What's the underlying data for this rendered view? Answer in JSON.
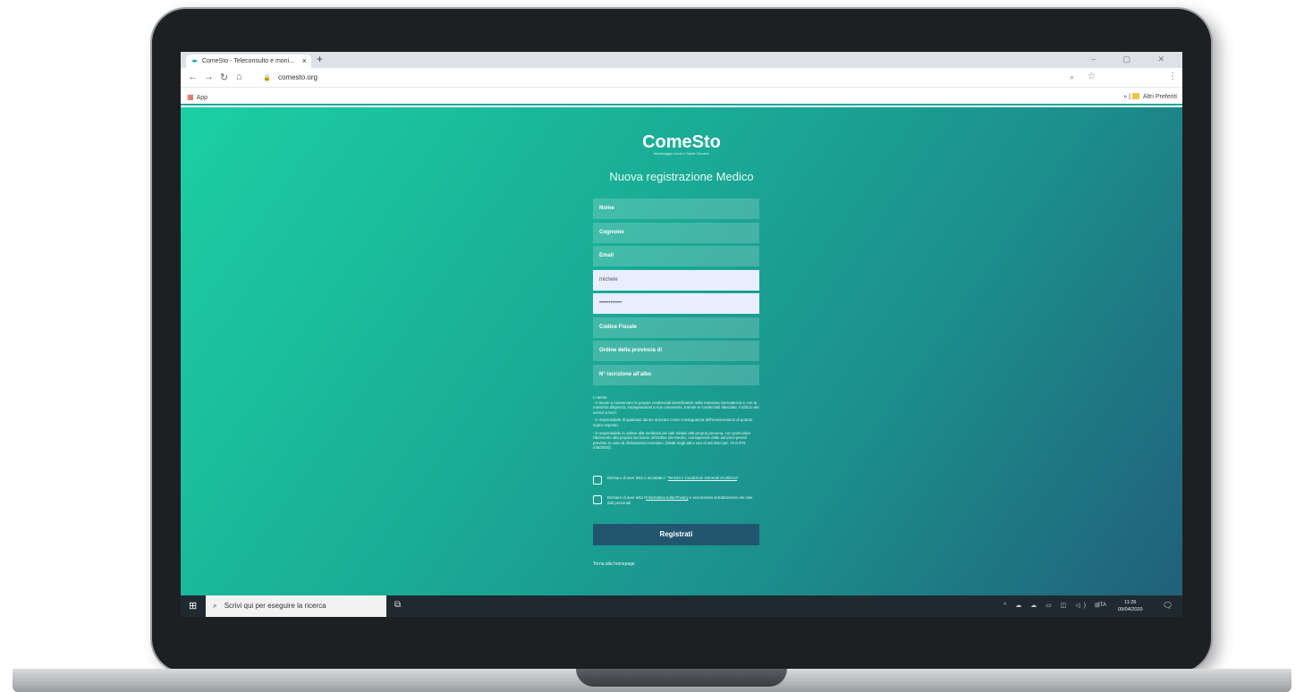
{
  "browser": {
    "tab_title": "ComeSto - Teleconsulto e moni...",
    "tab_close": "×",
    "new_tab": "+",
    "window_controls": "– ▢ ✕",
    "url": "comesto.org",
    "bookmarks_apps": "App",
    "bookmarks_other_prefix": "»",
    "bookmarks_other": "Altri Preferiti"
  },
  "page": {
    "logo": "ComeSto",
    "logo_subtitle": "Monitoraggio cronici e Salute Circolare",
    "title": "Nuova registrazione Medico",
    "fields": {
      "nome": "Nome",
      "cognome": "Cognome",
      "email": "Email",
      "username": "michele",
      "password": "••••••••••••",
      "codice_fiscale": "Codice Fiscale",
      "ordine": "Ordine della provincia di",
      "iscrizione": "N° iscrizione all'albo"
    },
    "notice": {
      "intro": "L'utente:",
      "p1": "- è tenuto a conservare le proprie credenziali identificative nella massima riservatezza e con la massima diligenza, impegnandosi a non consentire, tramite le credenziali rilasciate, l'utilizzo dei servizi a terzi;",
      "p2": "- è responsabile di qualsiasi danno arrecato come conseguenza dell'inosservanza di quanto sopra esposto;",
      "p3": "- è responsabile in ordine alla veridicità dei dati relativi alla propria persona, con particolare riferimento alla propria iscrizione all'Ordine dei Medici, consapevole delle sanzioni penali previste in caso di dichiarazioni mendaci, falsità negli atti e uso di atti falsi (art. 76 D.P.R. 445/2000)."
    },
    "consent_terms_prefix": "Dichiaro di aver letto e accettato i \"",
    "consent_terms_link": "Termini e Condizioni Generali di Utilizzo",
    "consent_terms_suffix": "\"",
    "consent_privacy_prefix": "Dichiaro di aver letto l'",
    "consent_privacy_link": "Informativa sulla Privacy",
    "consent_privacy_suffix": " e acconsento al trattamento dei miei dati personali",
    "submit": "Registrati",
    "home_link": "Torna alla homepage"
  },
  "taskbar": {
    "search_placeholder": "Scrivi qui per eseguire la ricerca",
    "tray_icons": "^ ☁ ☁ ▭ ◫ ◁) ⊞",
    "language": "ITA",
    "time": "11:26",
    "date": "09/04/2020"
  },
  "colors": {
    "gradient_start": "#1ccfa3",
    "gradient_end": "#21607a",
    "button": "#22566e",
    "taskbar": "#1f2a30"
  },
  "icons": [
    "favicon-icon",
    "back-icon",
    "forward-icon",
    "reload-icon",
    "home-icon",
    "lock-icon",
    "zoom-icon",
    "star-icon",
    "menu-icon",
    "apps-icon",
    "folder-icon",
    "windows-start-icon",
    "search-icon",
    "task-view-icon",
    "notification-icon"
  ]
}
